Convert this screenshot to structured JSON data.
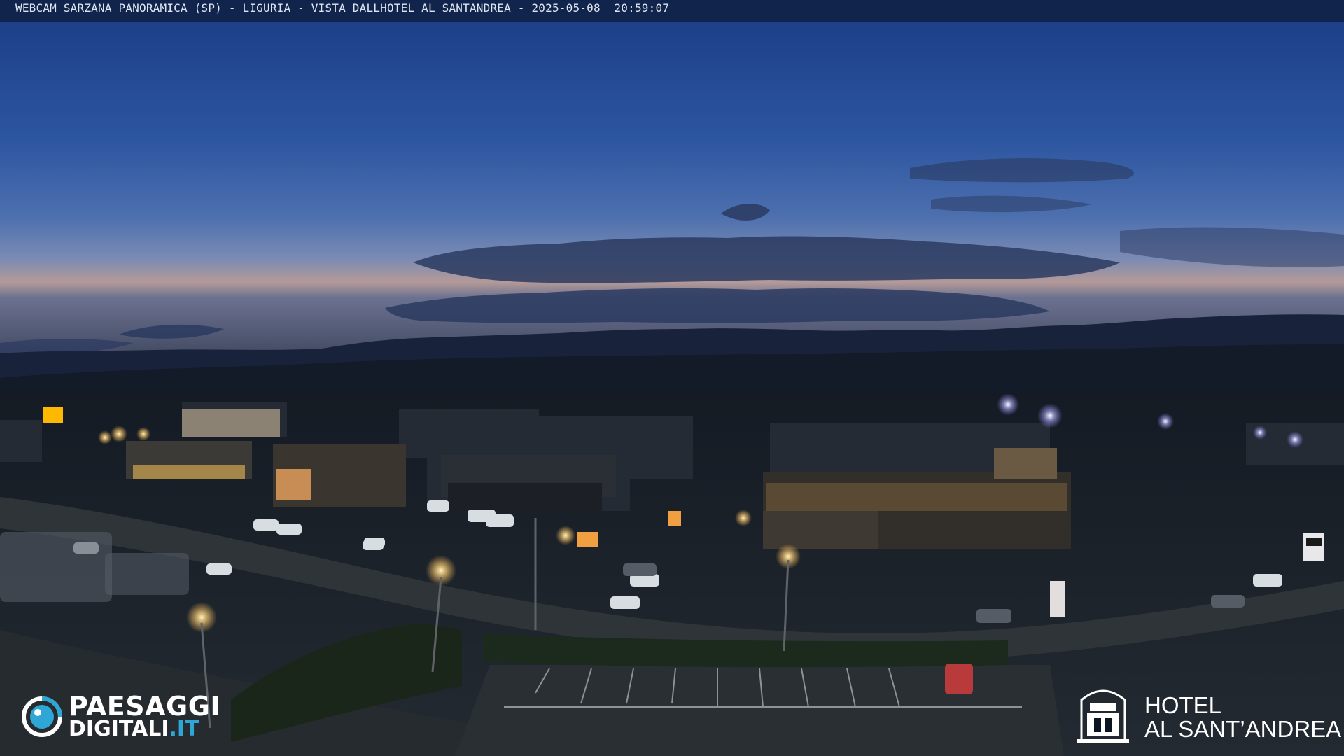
{
  "caption": {
    "text": "WEBCAM SARZANA PANORAMICA (SP) - LIGURIA - VISTA DALLHOTEL AL SANTANDREA - 2025-05-08  20:59:07"
  },
  "watermark_left": {
    "line1": "PAESAGGI",
    "line2_main": "DIGITALI",
    "line2_accent": ".IT"
  },
  "watermark_right": {
    "line1": "HOTEL",
    "line2": "AL SANT’ANDREA"
  },
  "scene": {
    "description_icons": [
      "sky",
      "clouds",
      "mountains",
      "town-lights",
      "roads",
      "parking-lots",
      "cars",
      "street-lamps"
    ],
    "colors": {
      "sky_top": "#1b3f86",
      "sky_mid": "#3a63a8",
      "horizon_glow": "#c49a86",
      "mountains": "#141c2c",
      "ground": "#1c232b",
      "lamp": "#ffd98a"
    }
  }
}
